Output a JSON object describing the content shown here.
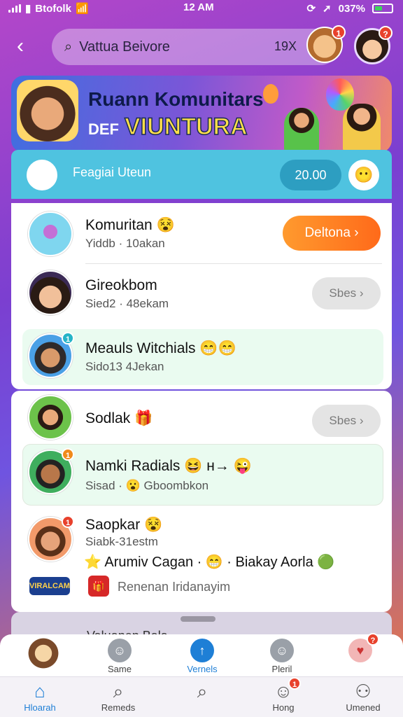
{
  "status_bar": {
    "carrier": "Btofolk",
    "time": "12 AM",
    "battery": "037%"
  },
  "search": {
    "text": "Vattua Beivore",
    "count": "19X"
  },
  "header_badges": {
    "mascot": "1",
    "avatar": "?"
  },
  "banner": {
    "line1": "Ruann Komunitars",
    "line2_prefix": "DEF",
    "line2": "VIUNTURA"
  },
  "highlight": {
    "label": "Feagiai Uteun",
    "pill": "20.00"
  },
  "list": [
    {
      "name": "Komuritan",
      "emoji": "😵",
      "sub": "Yiddb · 10akan",
      "button": "Deltona ›",
      "button_style": "orange"
    },
    {
      "name": "Gireokbom",
      "emoji": "",
      "sub": "Sied2 · 48ekam",
      "button": "Sbes ›",
      "button_style": "grey"
    },
    {
      "name": "Meauls Witchials",
      "emoji": "😁😁",
      "sub": "Sido13 4Jekan",
      "badge": "1",
      "badge_color": "#25b4c7"
    },
    {
      "name": "Sodlak",
      "emoji": "🎁",
      "sub": "",
      "button": "Sbes ›",
      "button_style": "grey"
    },
    {
      "name": "Namki Radials",
      "emoji": "😆 н→ 😜",
      "sub": "Sisad · 😮 Gboombkon",
      "badge": "1",
      "badge_color": "#f08a1a"
    },
    {
      "name": "Saopkar",
      "emoji": "😵",
      "sub": "Siabk-31estm",
      "badge": "1",
      "badge_color": "#e8412c",
      "feature": "⭐ Arumiv Cagan · 😁 · Biakay Aorla 🟢",
      "tag_logo": "VIRALCAM",
      "tag_text": "Renenan Iridanayim"
    }
  ],
  "peek": {
    "text": "Valuanen Bala"
  },
  "subbar": [
    {
      "label": "Same",
      "icon": "face-icon"
    },
    {
      "label": "Vernels",
      "icon": "up-arrow-icon"
    },
    {
      "label": "Pleril",
      "icon": "face-icon"
    },
    {
      "label": "",
      "icon": "heart-icon",
      "badge": "?"
    }
  ],
  "nav": [
    {
      "label": "Hloarah",
      "icon": "home-icon"
    },
    {
      "label": "Remeds",
      "icon": "search-icon"
    },
    {
      "label": "",
      "icon": "search-icon"
    },
    {
      "label": "Hong",
      "icon": "face-icon",
      "badge": "1"
    },
    {
      "label": "Umened",
      "icon": "person-icon"
    }
  ],
  "colors": {
    "accent_orange": "#ff7a1f",
    "highlight_teal": "#4fc3e0",
    "nav_active": "#1e7fd6"
  }
}
